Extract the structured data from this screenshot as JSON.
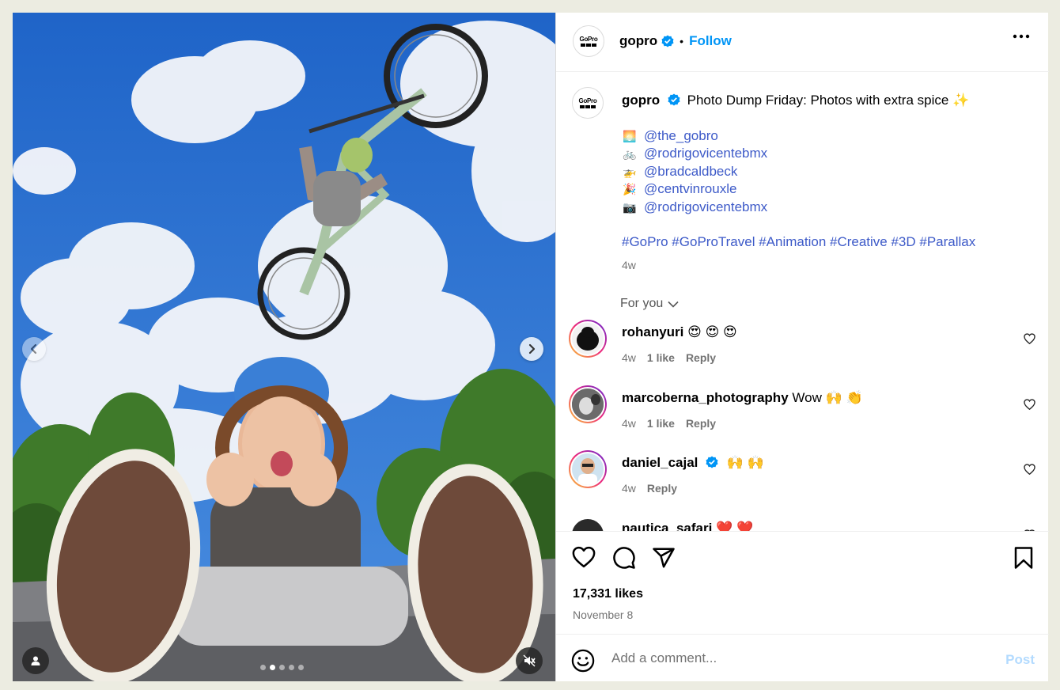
{
  "post": {
    "author": "gopro",
    "follow_label": "Follow",
    "separator": "•",
    "logo_text": "GoPro",
    "caption": "Photo Dump Friday: Photos with extra spice ✨",
    "tags": [
      {
        "emoji": "🌅",
        "handle": "@the_gobro"
      },
      {
        "emoji": "🚲",
        "handle": "@rodrigovicentebmx"
      },
      {
        "emoji": "🚁",
        "handle": "@bradcaldbeck"
      },
      {
        "emoji": "🎉",
        "handle": "@centvinrouxle"
      },
      {
        "emoji": "📷",
        "handle": "@rodrigovicentebmx"
      }
    ],
    "hashtags": "#GoPro #GoProTravel #Animation #Creative #3D #Parallax",
    "age": "4w",
    "for_you_label": "For you"
  },
  "comments": [
    {
      "user": "rohanyuri",
      "text": "😍 😍 😍",
      "age": "4w",
      "likes": "1 like",
      "reply": "Reply"
    },
    {
      "user": "marcoberna_photography",
      "text": "Wow 🙌 👏",
      "age": "4w",
      "likes": "1 like",
      "reply": "Reply"
    },
    {
      "user": "daniel_cajal",
      "text": "🙌 🙌",
      "age": "4w",
      "likes": "",
      "reply": "Reply"
    },
    {
      "user": "nautica_safari",
      "text": "❤️ ❤️",
      "age": "",
      "likes": "",
      "reply": ""
    }
  ],
  "footer": {
    "likes": "17,331 likes",
    "date": "November 8",
    "comment_placeholder": "Add a comment...",
    "post_label": "Post"
  },
  "carousel": {
    "slides": 5,
    "active_index": 1
  },
  "colors": {
    "accent": "#0095f6",
    "verified": "#0095f6",
    "link": "#3d5ac8",
    "post_disabled": "#b3dbff"
  },
  "icons": [
    "chevron-left-icon",
    "chevron-right-icon",
    "user-tag-icon",
    "mute-icon",
    "verified-icon",
    "more-icon",
    "heart-icon",
    "comment-icon",
    "share-icon",
    "bookmark-icon",
    "emoji-icon",
    "chevron-down-icon"
  ]
}
